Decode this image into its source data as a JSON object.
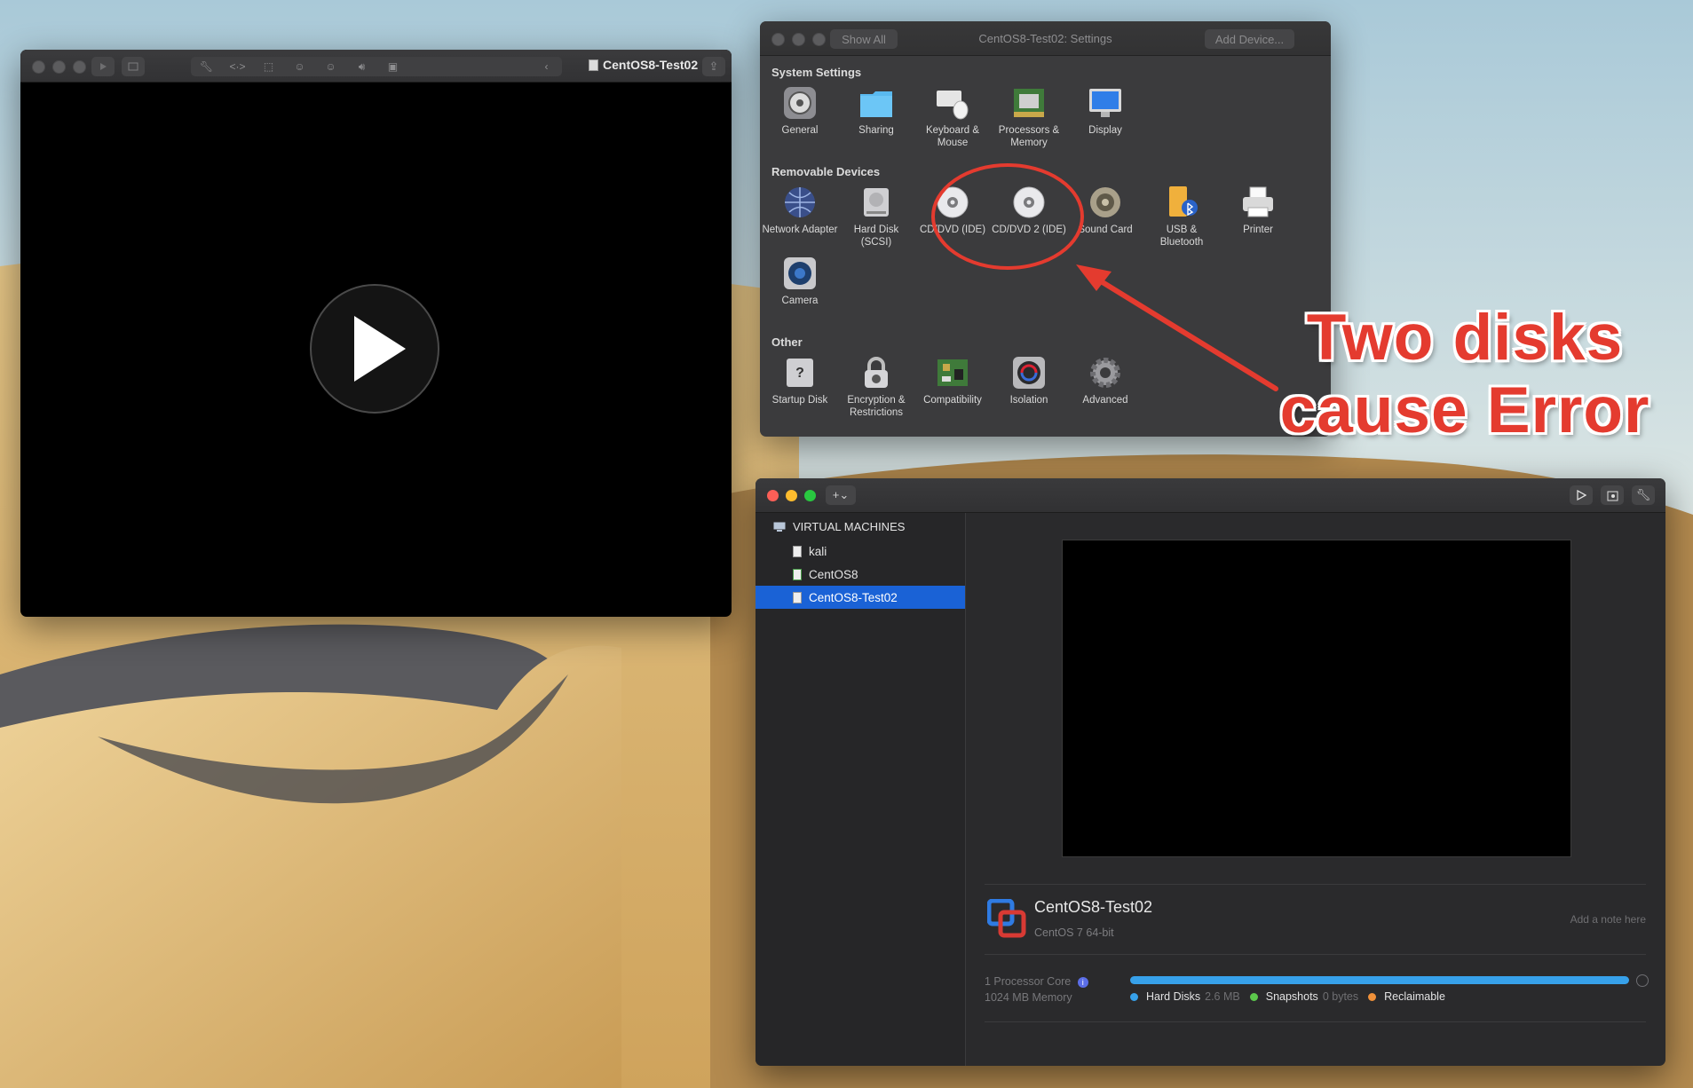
{
  "console_window": {
    "title": "CentOS8-Test02",
    "toolbar_icons": [
      "wrench-icon",
      "code-icon",
      "disk-icon",
      "user-icon",
      "user-icon",
      "speaker-icon",
      "camera-icon"
    ]
  },
  "settings_window": {
    "title": "CentOS8-Test02: Settings",
    "show_all": "Show All",
    "add_device": "Add Device...",
    "sections": {
      "system": "System Settings",
      "removable": "Removable Devices",
      "other": "Other"
    },
    "system_items": [
      {
        "label": "General",
        "icon": "gear-switch-icon"
      },
      {
        "label": "Sharing",
        "icon": "folder-icon"
      },
      {
        "label": "Keyboard & Mouse",
        "icon": "keyboard-mouse-icon"
      },
      {
        "label": "Processors & Memory",
        "icon": "chip-icon"
      },
      {
        "label": "Display",
        "icon": "monitor-icon"
      }
    ],
    "removable_items": [
      {
        "label": "Network Adapter",
        "icon": "globe-icon"
      },
      {
        "label": "Hard Disk (SCSI)",
        "icon": "hard-disk-icon"
      },
      {
        "label": "CD/DVD (IDE)",
        "icon": "cd-icon"
      },
      {
        "label": "CD/DVD 2 (IDE)",
        "icon": "cd-icon"
      },
      {
        "label": "Sound Card",
        "icon": "speaker-icon"
      },
      {
        "label": "USB & Bluetooth",
        "icon": "usb-bluetooth-icon"
      },
      {
        "label": "Printer",
        "icon": "printer-icon"
      },
      {
        "label": "Camera",
        "icon": "camera-icon"
      }
    ],
    "other_items": [
      {
        "label": "Startup Disk",
        "icon": "startup-disk-icon"
      },
      {
        "label": "Encryption & Restrictions",
        "icon": "padlock-icon"
      },
      {
        "label": "Compatibility",
        "icon": "circuit-board-icon"
      },
      {
        "label": "Isolation",
        "icon": "isolation-icon"
      },
      {
        "label": "Advanced",
        "icon": "gear-icon"
      }
    ]
  },
  "library_window": {
    "sidebar_heading": "VIRTUAL MACHINES",
    "vms": [
      "kali",
      "CentOS8",
      "CentOS8-Test02"
    ],
    "selected_vm": "CentOS8-Test02",
    "vm_name": "CentOS8-Test02",
    "vm_os": "CentOS 7 64-bit",
    "note_placeholder": "Add a note here",
    "processor": "1 Processor Core",
    "memory": "1024 MB Memory",
    "storage_legend": [
      {
        "key": "Hard Disks",
        "value": "2.6 MB",
        "color": "#37a1ea"
      },
      {
        "key": "Snapshots",
        "value": "0 bytes",
        "color": "#5cc84c"
      },
      {
        "key": "Reclaimable",
        "value": "",
        "color": "#f0913a"
      }
    ],
    "storage_used_fraction": 1.0
  },
  "annotation": {
    "line1": "Two disks",
    "line2": "cause Error",
    "color": "#e43b2f"
  }
}
